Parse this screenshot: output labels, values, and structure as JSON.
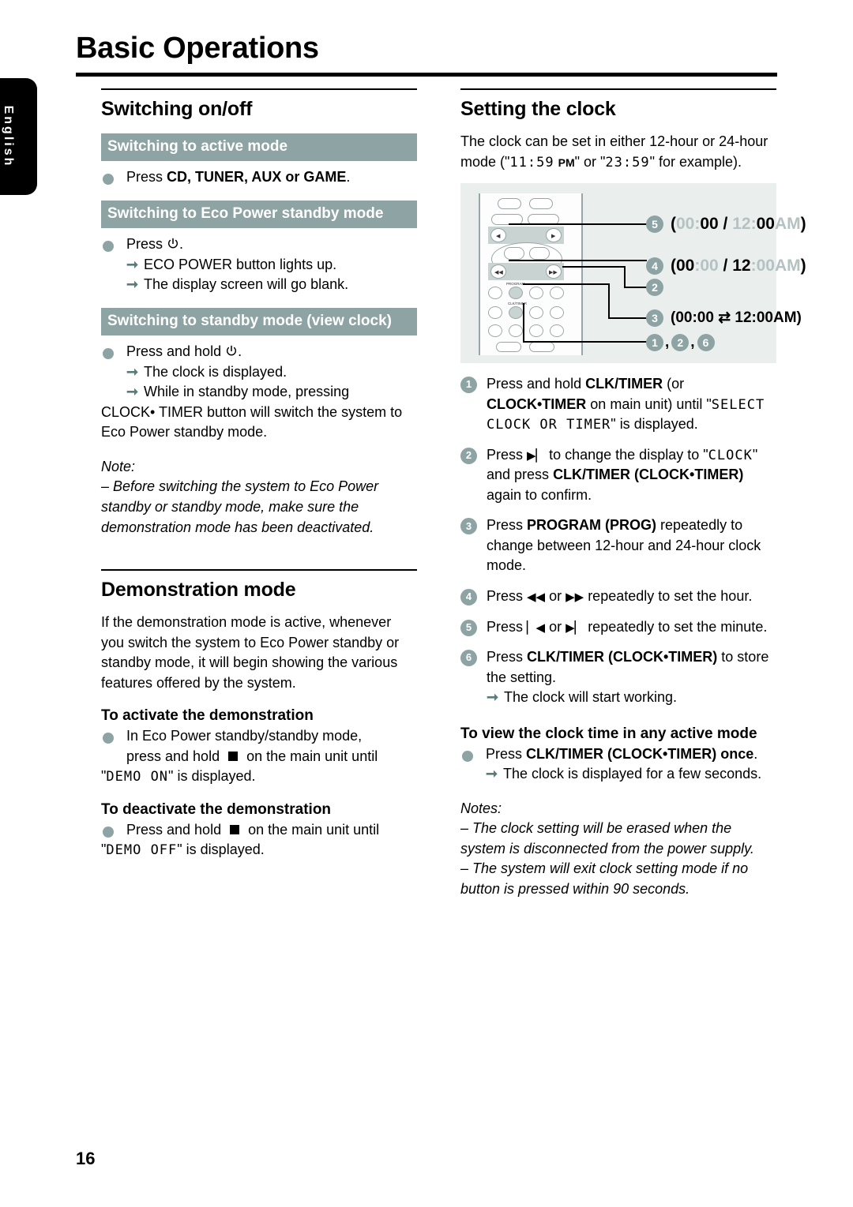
{
  "page": {
    "title": "Basic Operations",
    "number": "16",
    "language_tab": "English"
  },
  "left_column": {
    "section_title": "Switching on/off",
    "bars": {
      "active_mode": "Switching to active mode",
      "eco_standby": "Switching to Eco Power standby mode",
      "standby_view_clock": "Switching to standby mode (view clock)"
    },
    "active_mode": {
      "press_prefix": "Press ",
      "keys": "CD, TUNER, AUX or GAME",
      "period": "."
    },
    "eco_standby": {
      "press": "Press ",
      "power_icon": "power-icon",
      "period": ".",
      "result1": "ECO POWER button lights up.",
      "result2": "The display screen will go blank."
    },
    "standby_view_clock": {
      "press": "Press and hold ",
      "power_icon": "power-icon",
      "period": ".",
      "result1": "The clock is displayed.",
      "result2": "While in standby mode, pressing",
      "result2_cont": "CLOCK• TIMER button will switch the system to Eco Power standby mode."
    },
    "note": {
      "label": "Note:",
      "text": "–  Before switching the system to Eco Power standby or standby mode, make sure the demonstration mode has been deactivated."
    },
    "demo": {
      "section_title": "Demonstration mode",
      "intro": "If the demonstration mode is active, whenever you switch the system to Eco Power standby or standby mode, it will begin showing the various features offered by the system.",
      "activate_head": "To activate the demonstration",
      "activate_line1": "In Eco Power standby/standby mode,",
      "activate_line2_a": "press and hold ",
      "activate_stop_icon": "stop-square-icon",
      "activate_line2_b": " on the main unit until",
      "activate_lcd": "DEMO ON",
      "activate_line3": " is displayed.",
      "deactivate_head": "To deactivate the demonstration",
      "deactivate_line1_a": "Press and hold ",
      "deactivate_stop_icon": "stop-square-icon",
      "deactivate_line1_b": " on the main unit until",
      "deactivate_lcd": "DEMO OFF",
      "deactivate_line2": " is displayed."
    }
  },
  "right_column": {
    "section_title": "Setting the clock",
    "intro_a": "The clock can be set in either 12-hour or 24-hour mode (\"",
    "intro_lcd1": "11:59",
    "intro_pm": "PM",
    "intro_b": "\" or \"",
    "intro_lcd2": "23:59",
    "intro_c": "\" for example).",
    "diagram": {
      "remote_labels": {
        "program": "PROGRAM",
        "clk_timer": "CLK/TIMER"
      },
      "callouts": [
        {
          "num": "5",
          "text_parts": [
            {
              "t": "(",
              "style": "dark"
            },
            {
              "t": "00",
              "style": "light"
            },
            {
              "t": ":",
              "style": "light"
            },
            {
              "t": "00",
              "style": "dark"
            },
            {
              "t": " / ",
              "style": "dark"
            },
            {
              "t": "12",
              "style": "light"
            },
            {
              "t": ":",
              "style": "light"
            },
            {
              "t": "00",
              "style": "dark"
            },
            {
              "t": "AM",
              "style": "light"
            },
            {
              "t": ")",
              "style": "dark"
            }
          ]
        },
        {
          "num": "4",
          "text_parts": [
            {
              "t": "(",
              "style": "dark"
            },
            {
              "t": "00",
              "style": "dark"
            },
            {
              "t": ":00",
              "style": "light"
            },
            {
              "t": " / ",
              "style": "dark"
            },
            {
              "t": "12",
              "style": "dark"
            },
            {
              "t": ":00AM",
              "style": "light"
            },
            {
              "t": ")",
              "style": "dark"
            }
          ]
        },
        {
          "num": "2",
          "text_parts": []
        },
        {
          "num": "3",
          "text_parts": [
            {
              "t": "(00:00 ",
              "style": "dark"
            },
            {
              "t": "⇄",
              "style": "dark"
            },
            {
              "t": " 12:00AM)",
              "style": "dark"
            }
          ]
        },
        {
          "num": "1,2,6",
          "text_parts": []
        }
      ],
      "bottom_numbers": [
        "1",
        "2",
        "6"
      ]
    },
    "steps": [
      {
        "num": "1",
        "parts": [
          {
            "t": "Press and hold ",
            "style": "n"
          },
          {
            "t": "CLK/TIMER",
            "style": "b"
          },
          {
            "t": " (or ",
            "style": "n"
          },
          {
            "t": "CLOCK•TIMER",
            "style": "b"
          },
          {
            "t": " on main unit) until \"",
            "style": "n"
          },
          {
            "t": "SELECT CLOCK OR TIMER",
            "style": "lcd"
          },
          {
            "t": "\" is displayed.",
            "style": "n"
          }
        ]
      },
      {
        "num": "2",
        "parts": [
          {
            "t": "Press ",
            "style": "n"
          },
          {
            "t": "▶▏",
            "style": "icon"
          },
          {
            "t": " to change the display to \"",
            "style": "n"
          },
          {
            "t": "CLOCK",
            "style": "lcd"
          },
          {
            "t": "\" and press ",
            "style": "n"
          },
          {
            "t": "CLK/TIMER (CLOCK•TIMER)",
            "style": "b"
          },
          {
            "t": " again to confirm.",
            "style": "n"
          }
        ]
      },
      {
        "num": "3",
        "parts": [
          {
            "t": "Press ",
            "style": "n"
          },
          {
            "t": "PROGRAM (PROG)",
            "style": "b"
          },
          {
            "t": " repeatedly to change between 12-hour and 24-hour clock mode.",
            "style": "n"
          }
        ]
      },
      {
        "num": "4",
        "parts": [
          {
            "t": "Press ",
            "style": "n"
          },
          {
            "t": "◀◀",
            "style": "icon"
          },
          {
            "t": " or ",
            "style": "n"
          },
          {
            "t": "▶▶",
            "style": "icon"
          },
          {
            "t": " repeatedly to set the hour.",
            "style": "n"
          }
        ]
      },
      {
        "num": "5",
        "parts": [
          {
            "t": "Press ",
            "style": "n"
          },
          {
            "t": "▏◀",
            "style": "icon"
          },
          {
            "t": " or ",
            "style": "n"
          },
          {
            "t": "▶▏",
            "style": "icon"
          },
          {
            "t": " repeatedly to set the minute.",
            "style": "n"
          }
        ]
      },
      {
        "num": "6",
        "parts": [
          {
            "t": "Press ",
            "style": "n"
          },
          {
            "t": "CLK/TIMER (CLOCK•TIMER)",
            "style": "b"
          },
          {
            "t": " to store the setting.",
            "style": "n"
          }
        ],
        "result": "The clock will start working."
      }
    ],
    "view_clock": {
      "head": "To view the clock time in any active mode",
      "press": "Press ",
      "keys": "CLK/TIMER (CLOCK•TIMER) once",
      "period": ".",
      "result": "The clock is displayed for a few seconds."
    },
    "notes": {
      "label": "Notes:",
      "items": [
        "–  The clock setting will be erased when the system is disconnected from the power supply.",
        "–  The system will exit clock setting mode if no button is pressed within 90 seconds."
      ]
    }
  },
  "colors": {
    "accent_teal": "#8ea3a3",
    "diagram_bg": "#eaefee",
    "arrow_teal": "#5c7b7b"
  }
}
